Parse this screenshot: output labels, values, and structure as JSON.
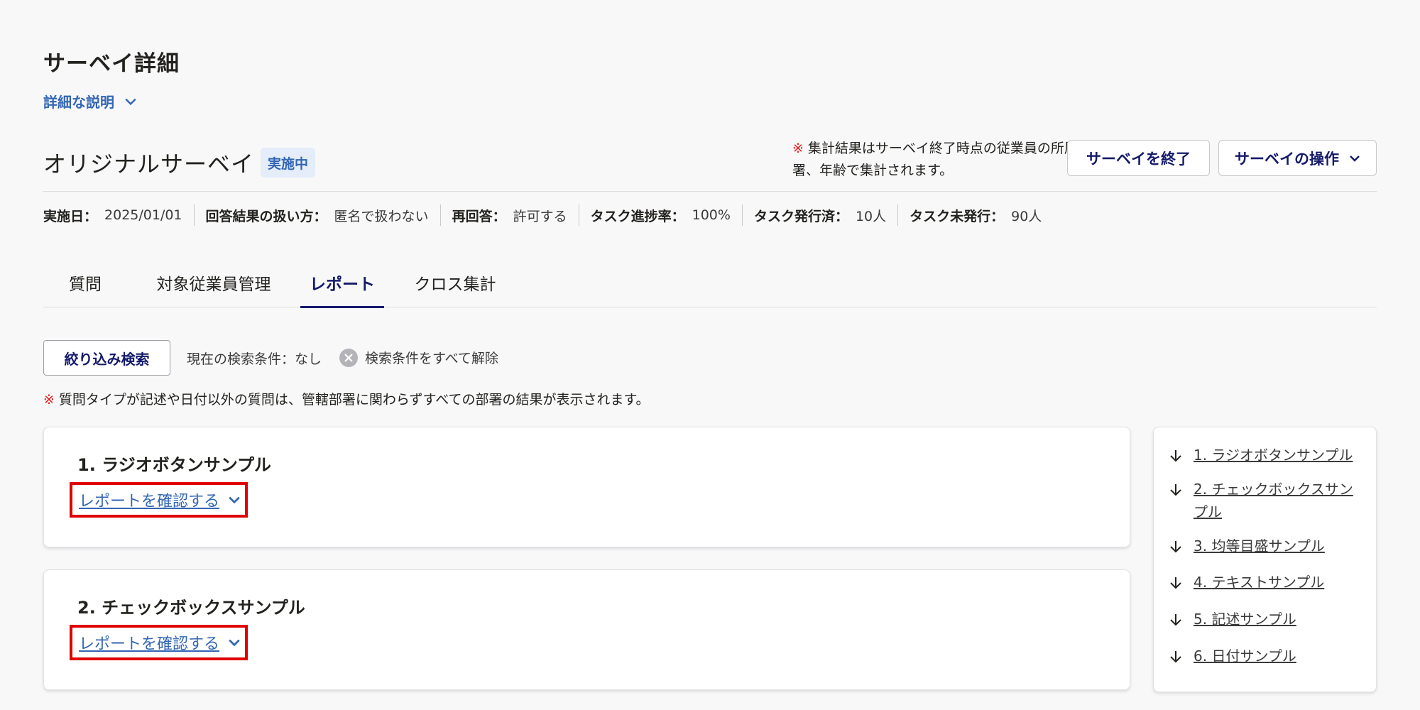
{
  "header": {
    "page_title": "サーベイ詳細",
    "description_toggle": "詳細な説明"
  },
  "survey": {
    "name": "オリジナルサーベイ",
    "status": "実施中",
    "aggregation_note_mark": "※",
    "aggregation_note": "集計結果はサーベイ終了時点の従業員の所属部署、年齢で集計されます。",
    "end_button": "サーベイを終了",
    "ops_button": "サーベイの操作"
  },
  "meta": [
    {
      "label": "実施日：",
      "value": "2025/01/01"
    },
    {
      "label": "回答結果の扱い方：",
      "value": "匿名で扱わない"
    },
    {
      "label": "再回答：",
      "value": "許可する"
    },
    {
      "label": "タスク進捗率：",
      "value": "100%"
    },
    {
      "label": "タスク発行済：",
      "value": "10人"
    },
    {
      "label": "タスク未発行：",
      "value": "90人"
    }
  ],
  "tabs": [
    {
      "label": "質問",
      "active": false
    },
    {
      "label": "対象従業員管理",
      "active": false
    },
    {
      "label": "レポート",
      "active": true
    },
    {
      "label": "クロス集計",
      "active": false
    }
  ],
  "filter": {
    "button": "絞り込み検索",
    "current_condition": "現在の検索条件：なし",
    "clear_all": "検索条件をすべて解除"
  },
  "notice": {
    "mark": "※",
    "text": "質問タイプが記述や日付以外の質問は、管轄部署に関わらずすべての部署の結果が表示されます。"
  },
  "questions": [
    {
      "title": "1. ラジオボタンサンプル",
      "link": "レポートを確認する"
    },
    {
      "title": "2. チェックボックスサンプル",
      "link": "レポートを確認する"
    }
  ],
  "toc": [
    "1. ラジオボタンサンプル",
    "2. チェックボックスサンプル",
    "3. 均等目盛サンプル",
    "4. テキストサンプル",
    "5. 記述サンプル",
    "6. 日付サンプル"
  ],
  "colors": {
    "accent": "#141a6b",
    "link": "#3366b3",
    "warning": "#e01e1e",
    "highlight_box": "#e00000"
  }
}
